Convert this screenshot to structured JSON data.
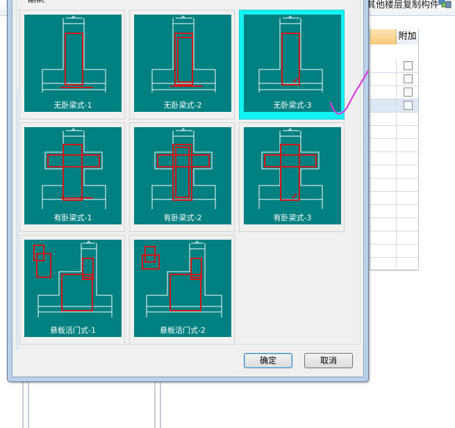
{
  "background_app": {
    "toolbar_text": "其他楼层复制构件",
    "toolbar_icon": "copy-layers-icon",
    "table": {
      "column_header": "附加",
      "rows": [
        {
          "checked": false
        },
        {
          "checked": false
        },
        {
          "checked": false
        },
        {
          "checked": false,
          "selected": true
        }
      ]
    }
  },
  "dialog": {
    "group_title": "图形",
    "options": [
      {
        "label": "无卧梁式-1",
        "selected": false
      },
      {
        "label": "无卧梁式-2",
        "selected": false
      },
      {
        "label": "无卧梁式-3",
        "selected": true
      },
      {
        "label": "有卧梁式-1",
        "selected": false
      },
      {
        "label": "有卧梁式-2",
        "selected": false
      },
      {
        "label": "有卧梁式-3",
        "selected": false
      },
      {
        "label": "悬板活门式-1",
        "selected": false
      },
      {
        "label": "悬板活门式-2",
        "selected": false
      }
    ],
    "buttons": {
      "ok": "确定",
      "cancel": "取消"
    }
  },
  "annotation": {
    "color": "#d73be0",
    "shape": "hand-drawn-check-mark"
  },
  "colors": {
    "thumb_bg": "#008080",
    "rebar": "#cc1111",
    "selection": "#13f2f2"
  }
}
